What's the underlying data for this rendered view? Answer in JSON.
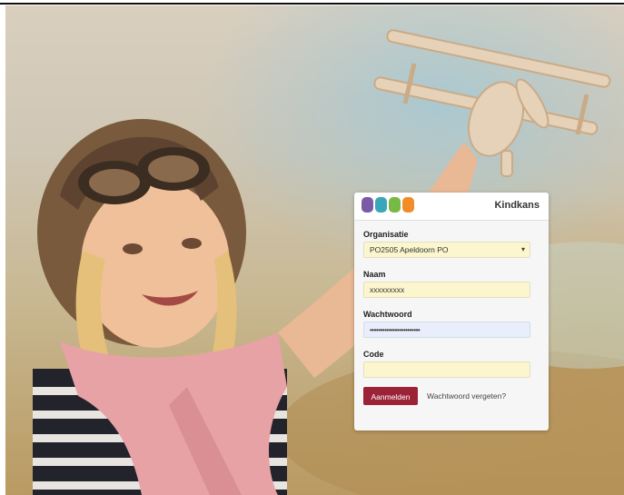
{
  "app": {
    "brand": "Kindkans"
  },
  "logo": {
    "colors": [
      "#7b5aa6",
      "#3aa6b9",
      "#78b844",
      "#f28c28"
    ]
  },
  "form": {
    "organisation": {
      "label": "Organisatie",
      "value": "PO2505 Apeldoorn PO"
    },
    "name": {
      "label": "Naam",
      "value": "xxxxxxxxx"
    },
    "password": {
      "label": "Wachtwoord",
      "value": "••••••••••••••••••••••••"
    },
    "code": {
      "label": "Code",
      "value": ""
    },
    "submit_label": "Aanmelden",
    "forgot_label": "Wachtwoord vergeten?"
  },
  "icons": {
    "select_chevron": "chevron-down-icon"
  },
  "colors": {
    "primary": "#9c2238",
    "field_yellow": "#fbf6cd",
    "field_blue": "#e8eefb"
  }
}
